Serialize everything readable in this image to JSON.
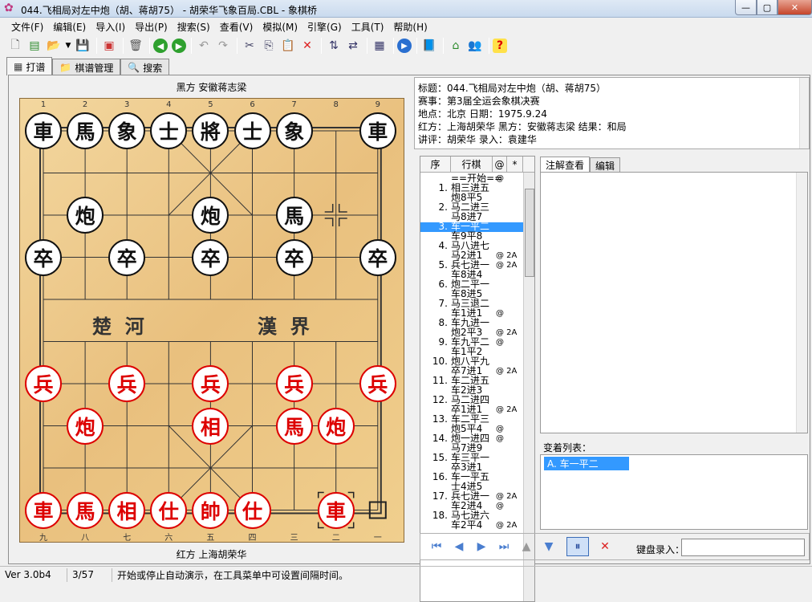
{
  "window": {
    "title": "044.飞相局对左中炮（胡、蒋胡75） - 胡荣华飞象百局.CBL - 象棋桥",
    "minimize": "—",
    "maximize": "▢",
    "close": "✕"
  },
  "menu": [
    "文件(F)",
    "编辑(E)",
    "导入(I)",
    "导出(P)",
    "搜索(S)",
    "查看(V)",
    "模拟(M)",
    "引擎(G)",
    "工具(T)",
    "帮助(H)"
  ],
  "tabs": [
    {
      "label": "打谱",
      "icon": "board-icon"
    },
    {
      "label": "棋谱管理",
      "icon": "folder-icon"
    },
    {
      "label": "搜索",
      "icon": "magnifier-icon"
    }
  ],
  "board": {
    "black_player": "黑方 安徽蒋志梁",
    "red_player": "红方 上海胡荣华",
    "river_left": "楚  河",
    "river_right": "漢  界",
    "top_coords": [
      "1",
      "2",
      "3",
      "4",
      "5",
      "6",
      "7",
      "8",
      "9"
    ],
    "bottom_coords": [
      "九",
      "八",
      "七",
      "六",
      "五",
      "四",
      "三",
      "二",
      "一"
    ],
    "pieces": [
      {
        "c": "車",
        "side": "black",
        "col": 0,
        "row": 0
      },
      {
        "c": "馬",
        "side": "black",
        "col": 1,
        "row": 0
      },
      {
        "c": "象",
        "side": "black",
        "col": 2,
        "row": 0
      },
      {
        "c": "士",
        "side": "black",
        "col": 3,
        "row": 0
      },
      {
        "c": "將",
        "side": "black",
        "col": 4,
        "row": 0
      },
      {
        "c": "士",
        "side": "black",
        "col": 5,
        "row": 0
      },
      {
        "c": "象",
        "side": "black",
        "col": 6,
        "row": 0
      },
      {
        "c": "車",
        "side": "black",
        "col": 8,
        "row": 0
      },
      {
        "c": "炮",
        "side": "black",
        "col": 1,
        "row": 2
      },
      {
        "c": "炮",
        "side": "black",
        "col": 4,
        "row": 2
      },
      {
        "c": "馬",
        "side": "black",
        "col": 6,
        "row": 2
      },
      {
        "c": "卒",
        "side": "black",
        "col": 0,
        "row": 3
      },
      {
        "c": "卒",
        "side": "black",
        "col": 2,
        "row": 3
      },
      {
        "c": "卒",
        "side": "black",
        "col": 4,
        "row": 3
      },
      {
        "c": "卒",
        "side": "black",
        "col": 6,
        "row": 3
      },
      {
        "c": "卒",
        "side": "black",
        "col": 8,
        "row": 3
      },
      {
        "c": "兵",
        "side": "red",
        "col": 0,
        "row": 6
      },
      {
        "c": "兵",
        "side": "red",
        "col": 2,
        "row": 6
      },
      {
        "c": "兵",
        "side": "red",
        "col": 4,
        "row": 6
      },
      {
        "c": "兵",
        "side": "red",
        "col": 6,
        "row": 6
      },
      {
        "c": "兵",
        "side": "red",
        "col": 8,
        "row": 6
      },
      {
        "c": "炮",
        "side": "red",
        "col": 1,
        "row": 7
      },
      {
        "c": "相",
        "side": "red",
        "col": 4,
        "row": 7
      },
      {
        "c": "馬",
        "side": "red",
        "col": 6,
        "row": 7
      },
      {
        "c": "炮",
        "side": "red",
        "col": 7,
        "row": 7
      },
      {
        "c": "車",
        "side": "red",
        "col": 0,
        "row": 9
      },
      {
        "c": "馬",
        "side": "red",
        "col": 1,
        "row": 9
      },
      {
        "c": "相",
        "side": "red",
        "col": 2,
        "row": 9
      },
      {
        "c": "仕",
        "side": "red",
        "col": 3,
        "row": 9
      },
      {
        "c": "帥",
        "side": "red",
        "col": 4,
        "row": 9
      },
      {
        "c": "仕",
        "side": "red",
        "col": 5,
        "row": 9
      },
      {
        "c": "車",
        "side": "red",
        "col": 7,
        "row": 9
      }
    ]
  },
  "info": {
    "title": "标题：044.飞相局对左中炮（胡、蒋胡75）",
    "event": "赛事：第3届全运会象棋决赛",
    "place_date": "地点：北京    日期：1975.9.24",
    "players": "红方：上海胡荣华    黑方：安徽蒋志梁    结果：和局",
    "commentary": "讲评：胡荣华    录入：袁建华"
  },
  "movelist": {
    "headers": [
      "序",
      "行棋",
      "@",
      "*"
    ],
    "rows": [
      {
        "num": "",
        "mv": "==开始==",
        "ann": "@"
      },
      {
        "num": "1.",
        "mv": "相三进五",
        "ann": ""
      },
      {
        "num": "",
        "mv": "炮8平5",
        "ann": ""
      },
      {
        "num": "2.",
        "mv": "马二进三",
        "ann": ""
      },
      {
        "num": "",
        "mv": "马8进7",
        "ann": ""
      },
      {
        "num": "3.",
        "mv": "车一平二",
        "ann": "",
        "sel": true
      },
      {
        "num": "",
        "mv": "车9平8",
        "ann": ""
      },
      {
        "num": "4.",
        "mv": "马八进七",
        "ann": ""
      },
      {
        "num": "",
        "mv": "马2进1",
        "ann": "@ 2A"
      },
      {
        "num": "5.",
        "mv": "兵七进一",
        "ann": "@ 2A"
      },
      {
        "num": "",
        "mv": "车8进4",
        "ann": ""
      },
      {
        "num": "6.",
        "mv": "炮二平一",
        "ann": ""
      },
      {
        "num": "",
        "mv": "车8进5",
        "ann": ""
      },
      {
        "num": "7.",
        "mv": "马三退二",
        "ann": ""
      },
      {
        "num": "",
        "mv": "车1进1",
        "ann": "@"
      },
      {
        "num": "8.",
        "mv": "车九进一",
        "ann": ""
      },
      {
        "num": "",
        "mv": "炮2平3",
        "ann": "@ 2A"
      },
      {
        "num": "9.",
        "mv": "车九平二",
        "ann": "@"
      },
      {
        "num": "",
        "mv": "车1平2",
        "ann": ""
      },
      {
        "num": "10.",
        "mv": "炮八平九",
        "ann": ""
      },
      {
        "num": "",
        "mv": "卒7进1",
        "ann": "@ 2A"
      },
      {
        "num": "11.",
        "mv": "车二进五",
        "ann": ""
      },
      {
        "num": "",
        "mv": "车2进3",
        "ann": ""
      },
      {
        "num": "12.",
        "mv": "马二进四",
        "ann": ""
      },
      {
        "num": "",
        "mv": "卒1进1",
        "ann": "@ 2A"
      },
      {
        "num": "13.",
        "mv": "车二平三",
        "ann": ""
      },
      {
        "num": "",
        "mv": "炮5平4",
        "ann": "@"
      },
      {
        "num": "14.",
        "mv": "炮一进四",
        "ann": "@"
      },
      {
        "num": "",
        "mv": "马7进9",
        "ann": ""
      },
      {
        "num": "15.",
        "mv": "车三平一",
        "ann": ""
      },
      {
        "num": "",
        "mv": "卒3进1",
        "ann": ""
      },
      {
        "num": "16.",
        "mv": "车一平五",
        "ann": ""
      },
      {
        "num": "",
        "mv": "士4进5",
        "ann": ""
      },
      {
        "num": "17.",
        "mv": "兵七进一",
        "ann": "@ 2A"
      },
      {
        "num": "",
        "mv": "车2进4",
        "ann": "@"
      },
      {
        "num": "18.",
        "mv": "马七进六",
        "ann": ""
      },
      {
        "num": "",
        "mv": "车2平4",
        "ann": "@ 2A"
      }
    ]
  },
  "comment_tabs": [
    "注解查看",
    "编辑"
  ],
  "variations": {
    "label": "变着列表：",
    "items": [
      "A. 车一平二"
    ]
  },
  "keyboard": {
    "label": "键盘录入："
  },
  "status": {
    "version": "Ver 3.0b4",
    "progress": "3/57",
    "hint": "开始或停止自动演示，在工具菜单中可设置间隔时间。"
  }
}
